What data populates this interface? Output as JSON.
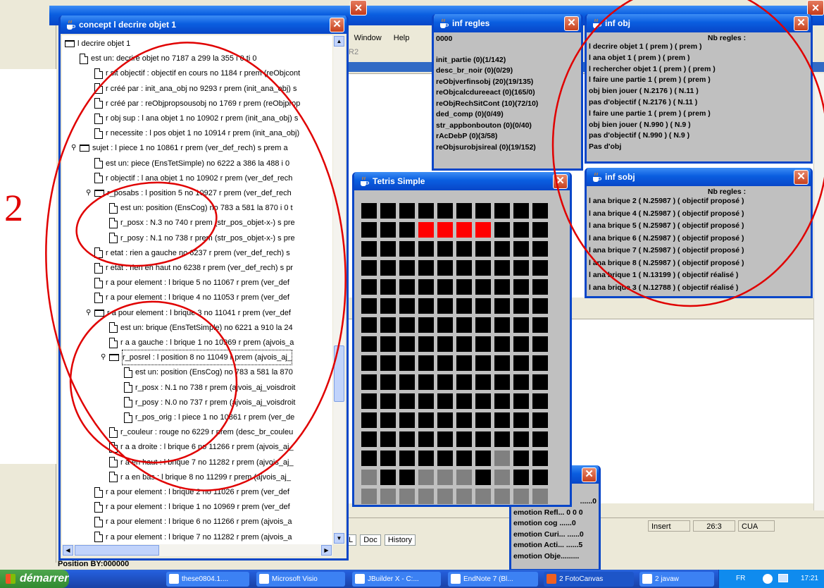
{
  "background_app": {
    "menu": [
      "s",
      "Window",
      "Help"
    ],
    "toolbar_label": "R2",
    "status": {
      "mode": "Insert",
      "position": "26:3",
      "keymap": "CUA"
    },
    "tabs": [
      "L",
      "Doc",
      "History"
    ],
    "position_label": "Position BY:000000"
  },
  "concept_window": {
    "title": "concept l decrire objet 1",
    "rows": [
      "l decrire objet 1",
      "est un: decrire objet no 7187 a 299 la 355 i 0 ti 0",
      "r sit objectif : objectif en cours no 1184 r prem (reObjcont",
      "r créé par : init_ana_obj no 9293 r prem (init_ana_obj) s",
      "r créé par : reObjpropsousobj no 1769 r prem (reObjprop",
      "r obj sup : l ana objet 1 no 10902 r prem (init_ana_obj) s",
      "r necessite : l pos objet 1 no 10914 r prem (init_ana_obj)",
      "sujet : l piece 1 no 10861 r prem (ver_def_rech) s prem a",
      "est un: piece (EnsTetSimple) no 6222 a 386 la 488 i 0",
      "r objectif : l ana objet 1 no 10902 r prem (ver_def_rech",
      "r_posabs : l position 5 no 10927 r prem (ver_def_rech",
      "est un: position (EnsCog) no 783 a 581 la 870 i 0 t",
      "r_posx : N.3 no 740 r prem (str_pos_objet-x-) s pre",
      "r_posy : N.1 no 738 r prem (str_pos_objet-x-) s pre",
      "r etat : rien a gauche no 6237 r prem (ver_def_rech) s",
      "r etat : rien en haut no 6238 r prem (ver_def_rech) s pr",
      "r a pour element : l brique 5 no 11067 r prem (ver_def",
      "r a pour element : l brique 4 no 11053 r prem (ver_def",
      "r a pour element : l brique 3 no 11041 r prem (ver_def",
      "est un: brique (EnsTetSimple) no 6221 a 910 la 24",
      "r a a gauche : l brique 1 no 10969 r prem (ajvois_a",
      "r_posrel : l position 8 no 11049 r prem (ajvois_aj_",
      "est un: position (EnsCog) no 783 a 581 la 870",
      "r_posx : N.1 no 738 r prem (ajvois_aj_voisdroit",
      "r_posy : N.0 no 737 r prem (ajvois_aj_voisdroit",
      "r_pos_orig : l piece 1 no 10861 r prem (ver_de",
      "r_couleur : rouge no 6229 r prem (desc_br_couleu",
      "r a a droite : l brique 6 no 11266 r prem (ajvois_aj_",
      "r a en haut : l brique 7 no 11282 r prem (ajvois_aj_",
      "r a en bas : l brique 8 no 11299 r prem (ajvois_aj_",
      "r a pour element : l brique 2 no 11026 r prem (ver_def",
      "r a pour element : l brique 1 no 10969 r prem (ver_def",
      "r a pour element : l brique 6 no 11266 r prem (ajvois_a",
      "r a pour element : l brique 7 no 11282 r prem (ajvois_a"
    ]
  },
  "regles_window": {
    "title": "inf regles",
    "header": "0000",
    "lines": [
      "init_partie (0)(1/142)",
      "desc_br_noir (0)(0/29)",
      "reObjverfinsobj (20)(19/135)",
      "reObjcalcdureeact (0)(165/0)",
      "reObjRechSitCont (10)(72/10)",
      "ded_comp (0)(0/49)",
      "str_appbonbouton (0)(0/40)",
      "rAcDebP (0)(3/58)",
      "reObjsurobjsireal (0)(19/152)"
    ]
  },
  "obj_window": {
    "title": "inf obj",
    "header": "Nb regles :",
    "lines": [
      "l decrire objet 1 ( prem ) ( prem )",
      "l ana objet 1 ( prem ) ( prem )",
      "l rechercher objet 1 ( prem ) ( prem )",
      "l faire une partie 1 ( prem ) ( prem )",
      "obj bien jouer ( N.2176 ) ( N.11 )",
      "pas d'objectif ( N.2176 ) ( N.11 )",
      "l faire une partie 1 ( prem ) ( prem )",
      "obj bien jouer ( N.990 ) ( N.9 )",
      "pas d'objectif ( N.990 ) ( N.9 )",
      "Pas d'obj"
    ]
  },
  "sobj_window": {
    "title": "inf sobj",
    "header": "Nb regles :",
    "lines": [
      "l ana brique 2 ( N.25987 ) ( objectif proposé )",
      "l ana brique 4 ( N.25987 ) ( objectif proposé )",
      "l ana brique 5 ( N.25987 ) ( objectif proposé )",
      "l ana brique 6 ( N.25987 ) ( objectif proposé )",
      "l ana brique 7 ( N.25987 ) ( objectif proposé )",
      "l ana brique 8 ( N.25987 ) ( objectif proposé )",
      "l ana brique 1 ( N.13199 ) ( objectif réalisé )",
      "l ana brique 3 ( N.12788 ) ( objectif réalisé )",
      "-"
    ]
  },
  "emotion_window": {
    "lines": [
      "......0",
      "emotion Refl... 0 0 0",
      "emotion cog ......0",
      "emotion Curi... ......0",
      "emotion Acti... ......5",
      "emotion Obje........."
    ]
  },
  "tetris_window": {
    "title": "Tetris Simple",
    "grid_rows": [
      "KKKKKKKKKK",
      "KKKRRRRKKK",
      "KKKKKKKKKK",
      "KKKKKKKKKK",
      "KKKKKKKKKK",
      "KKKKKKKKKK",
      "KKKKKKKKKK",
      "KKKKKKKKKK",
      "KKKKKKKKKK",
      "KKKKKKKKKK",
      "KKKKKKKKKK",
      "KKKKKKKKKK",
      "KKKKKKKKKK",
      "KKKKKKKGKK",
      "GKKGGGKGKK",
      "GGGGGGGGGG"
    ],
    "colors": {
      "K": "#000000",
      "R": "#ff0000",
      "G": "#808080"
    }
  },
  "taskbar": {
    "start": "démarrer",
    "buttons": [
      "these0804.1....",
      "Microsoft Visio",
      "JBuilder X - C:...",
      "EndNote 7 (Bl...",
      "2 FotoCanvas",
      "2 javaw"
    ],
    "lang": "FR",
    "clock": "17:21"
  },
  "annotation": {
    "label": "2",
    "color": "#e00000"
  }
}
